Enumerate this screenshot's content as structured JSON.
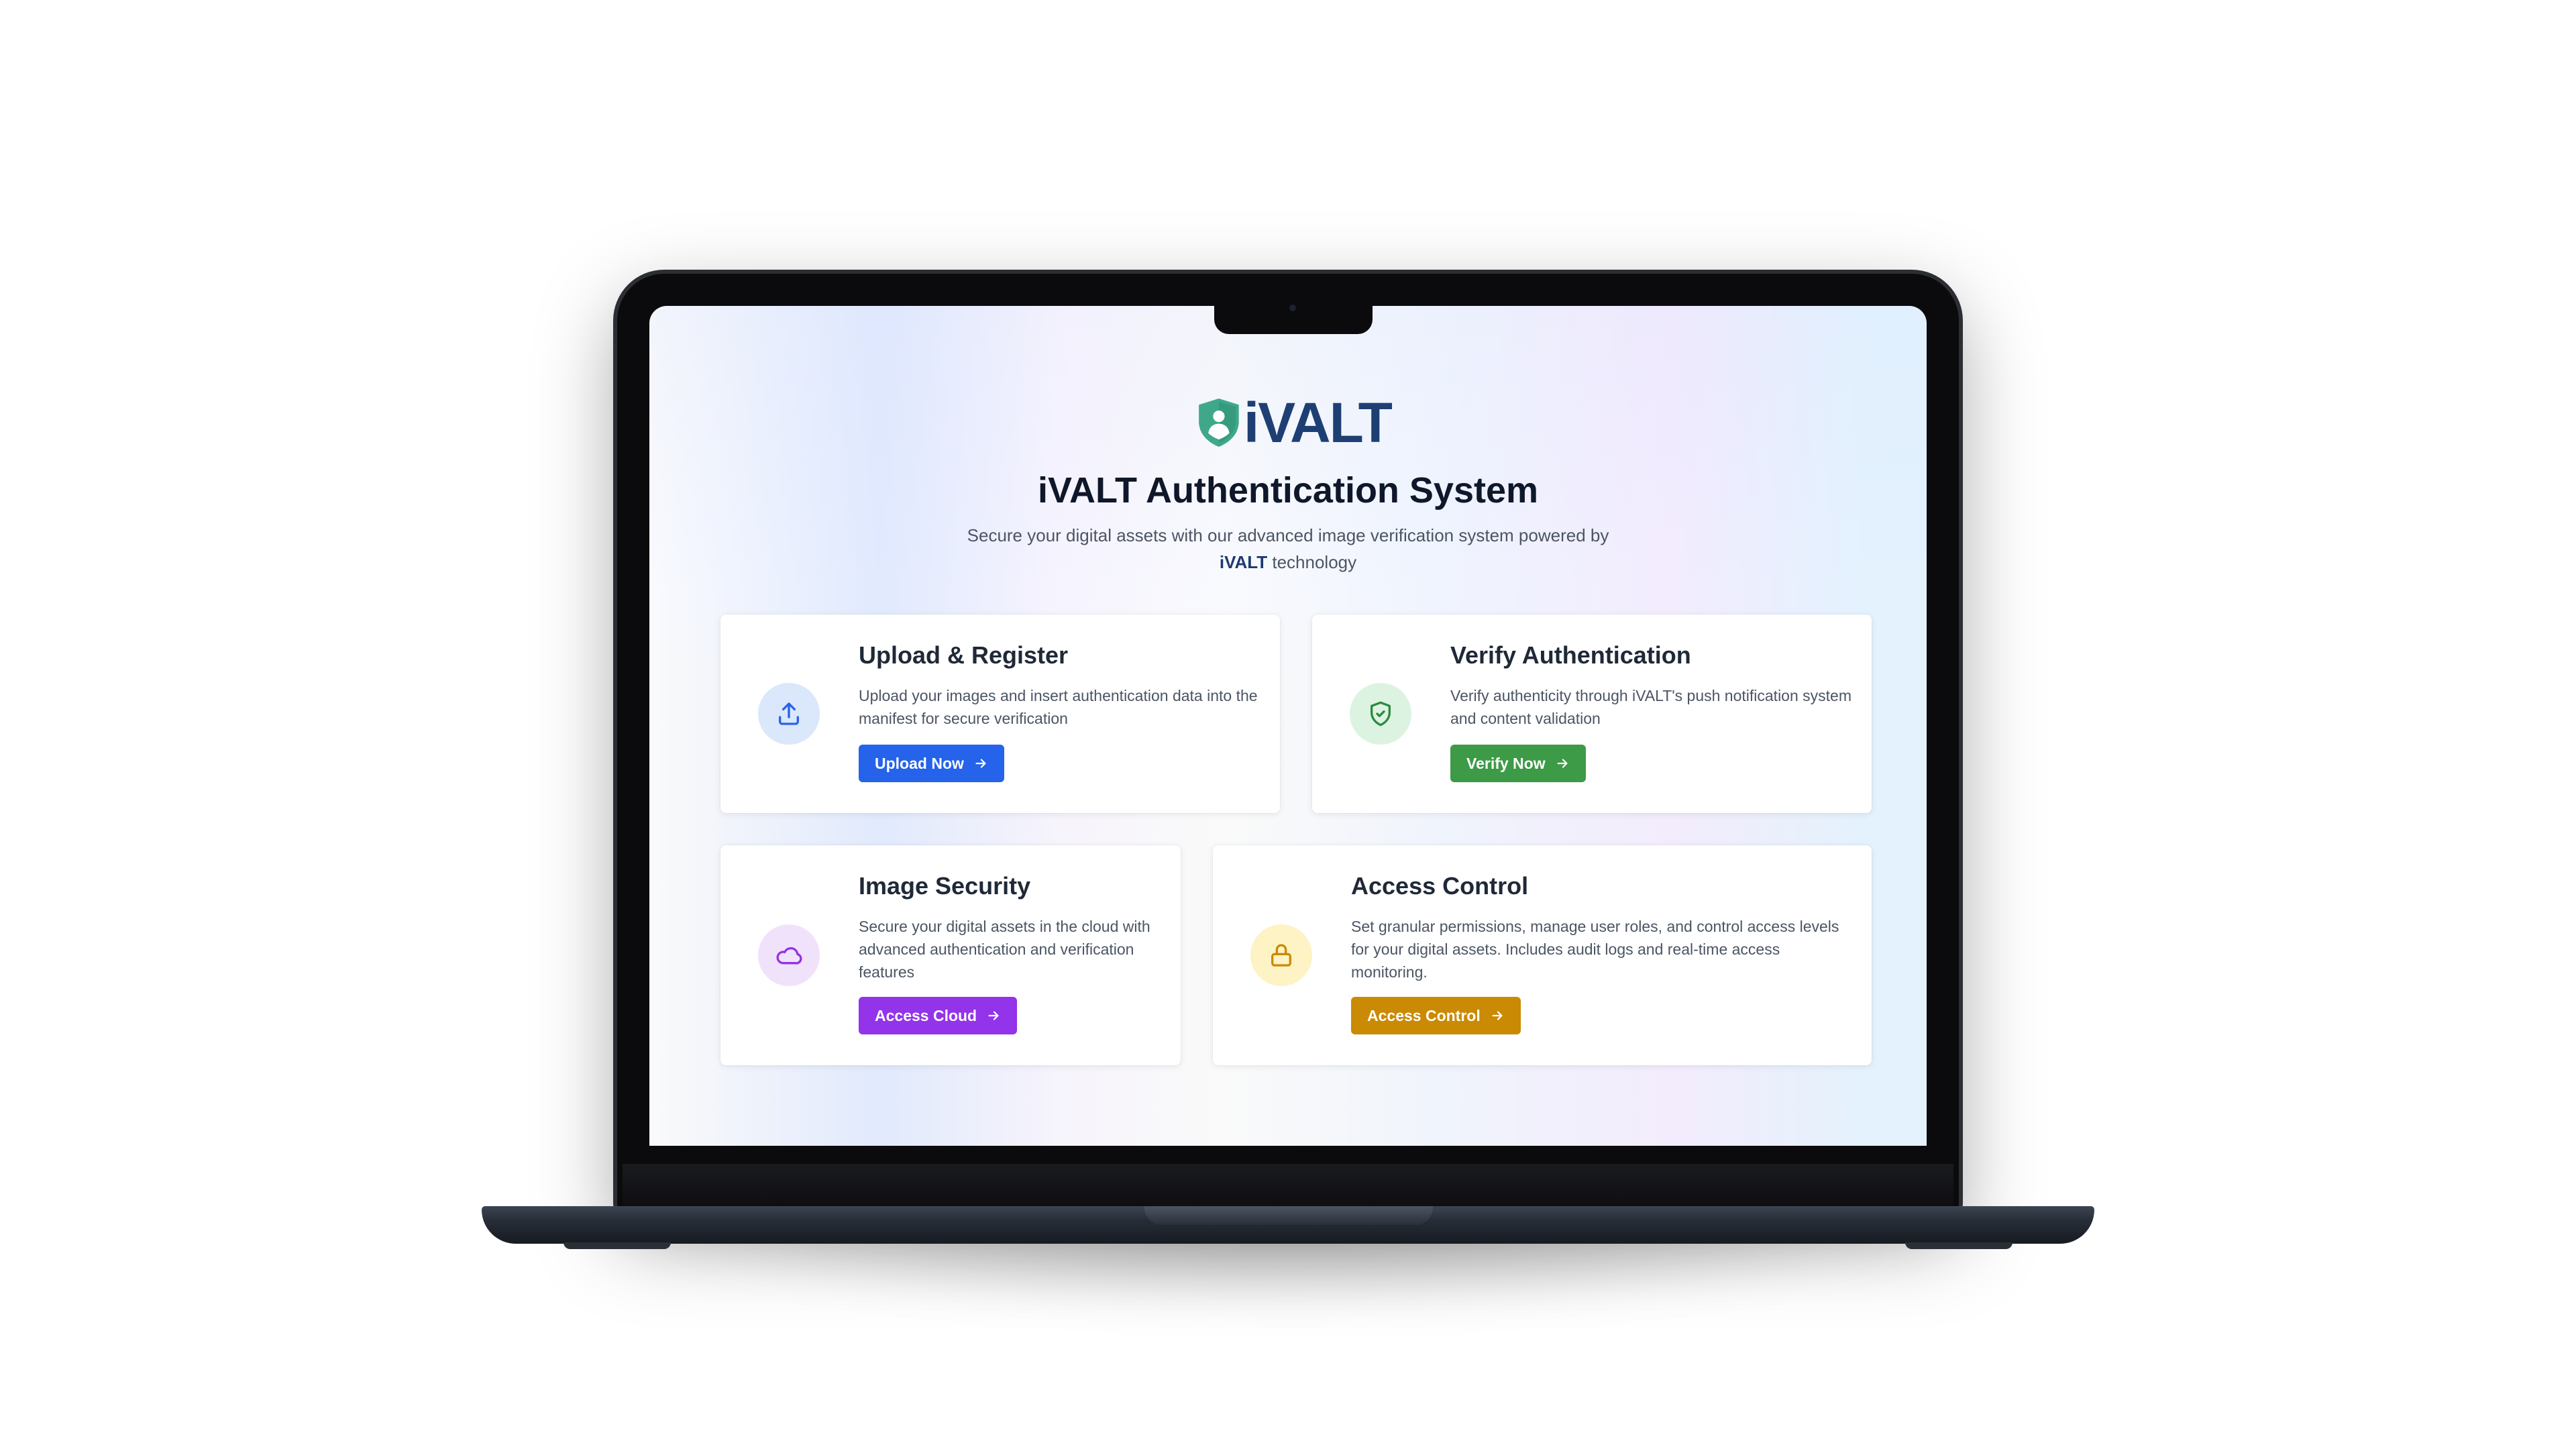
{
  "brand": {
    "logo_text": "iVALT",
    "accent": "#1e3f73",
    "shield_color": "#3fa88a"
  },
  "hero": {
    "title": "iVALT Authentication System",
    "subtitle_pre": "Secure your digital assets with our advanced image verification system powered by ",
    "subtitle_brand": "iVALT",
    "subtitle_post": " technology"
  },
  "cards": {
    "upload": {
      "title": "Upload & Register",
      "description": "Upload your images and insert authentication data into the manifest for secure verification",
      "button": "Upload Now",
      "icon": "upload-icon",
      "color": "#2563eb"
    },
    "verify": {
      "title": "Verify Authentication",
      "description": "Verify authenticity through iVALT's push notification system and content validation",
      "button": "Verify Now",
      "icon": "shield-check-icon",
      "color": "#3d9a47"
    },
    "security": {
      "title": "Image Security",
      "description": "Secure your digital assets in the cloud with advanced authentication and verification features",
      "button": "Access Cloud",
      "icon": "cloud-icon",
      "color": "#9333ea"
    },
    "access": {
      "title": "Access Control",
      "description": "Set granular permissions, manage user roles, and control access levels for your digital assets. Includes audit logs and real-time access monitoring.",
      "button": "Access Control",
      "icon": "lock-icon",
      "color": "#ca8a04"
    }
  }
}
